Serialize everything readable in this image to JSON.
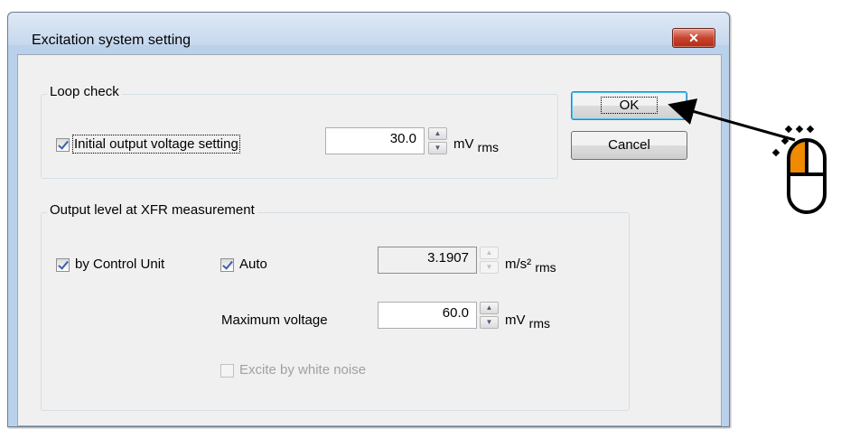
{
  "window": {
    "title": "Excitation system setting",
    "close_label": "✕"
  },
  "loop_check": {
    "group_label": "Loop check",
    "initial_output_label": "Initial output voltage setting",
    "initial_output_checked": true,
    "initial_output_value": "30.0",
    "unit_main": "mV",
    "unit_sub": "rms"
  },
  "buttons": {
    "ok": "OK",
    "cancel": "Cancel"
  },
  "xfr": {
    "group_label": "Output level at XFR measurement",
    "by_control_unit_label": "by Control Unit",
    "by_control_unit_checked": true,
    "auto_label": "Auto",
    "auto_checked": true,
    "auto_value": "3.1907",
    "accel_unit_main": "m/s²",
    "accel_unit_sub": "rms",
    "max_voltage_label": "Maximum voltage",
    "max_voltage_value": "60.0",
    "voltage_unit_main": "mV",
    "voltage_unit_sub": "rms",
    "white_noise_label": "Excite by white noise",
    "white_noise_checked": false,
    "white_noise_enabled": false
  },
  "icons": {
    "mouse": "mouse-left-click-icon",
    "arrow": "pointer-arrow"
  },
  "colors": {
    "mouse_highlight": "#f08a00",
    "title_bar": "#c6d8ee",
    "close_button": "#c7442e"
  }
}
